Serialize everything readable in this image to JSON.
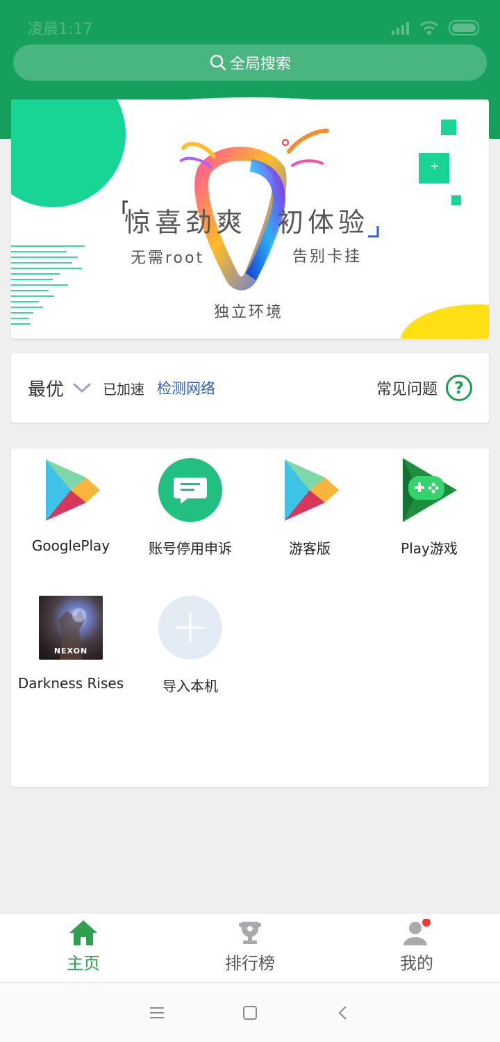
{
  "status_bar": {
    "time": "凌晨1:17"
  },
  "search": {
    "label": "全局搜索",
    "icon": "search-icon"
  },
  "banner": {
    "headline_left": "惊喜劲爽",
    "headline_right": "初体验",
    "tag_left": "无需root",
    "tag_right": "告别卡挂",
    "tag_bottom": "独立环境",
    "plus": "+"
  },
  "network": {
    "mode": "最优",
    "status": "已加速",
    "check_label": "检测网络",
    "faq_label": "常见问题",
    "faq_icon": "?"
  },
  "apps": [
    {
      "label": "GooglePlay",
      "icon": "google-play-icon"
    },
    {
      "label": "账号停用申诉",
      "icon": "chat-icon"
    },
    {
      "label": "游客版",
      "icon": "google-play-icon"
    },
    {
      "label": "Play游戏",
      "icon": "play-games-icon"
    },
    {
      "label": "Darkness Rises",
      "icon": "darkness-rises-icon",
      "badge": "NEXON"
    },
    {
      "label": "导入本机",
      "icon": "add-icon"
    }
  ],
  "bottom_nav": [
    {
      "label": "主页",
      "active": true
    },
    {
      "label": "排行榜",
      "active": false
    },
    {
      "label": "我的",
      "active": false
    }
  ],
  "colors": {
    "brand_green": "#17a05d",
    "accent_blue": "#2a5db0",
    "nav_active": "#2ea050",
    "notification_red": "#f03a3a"
  }
}
